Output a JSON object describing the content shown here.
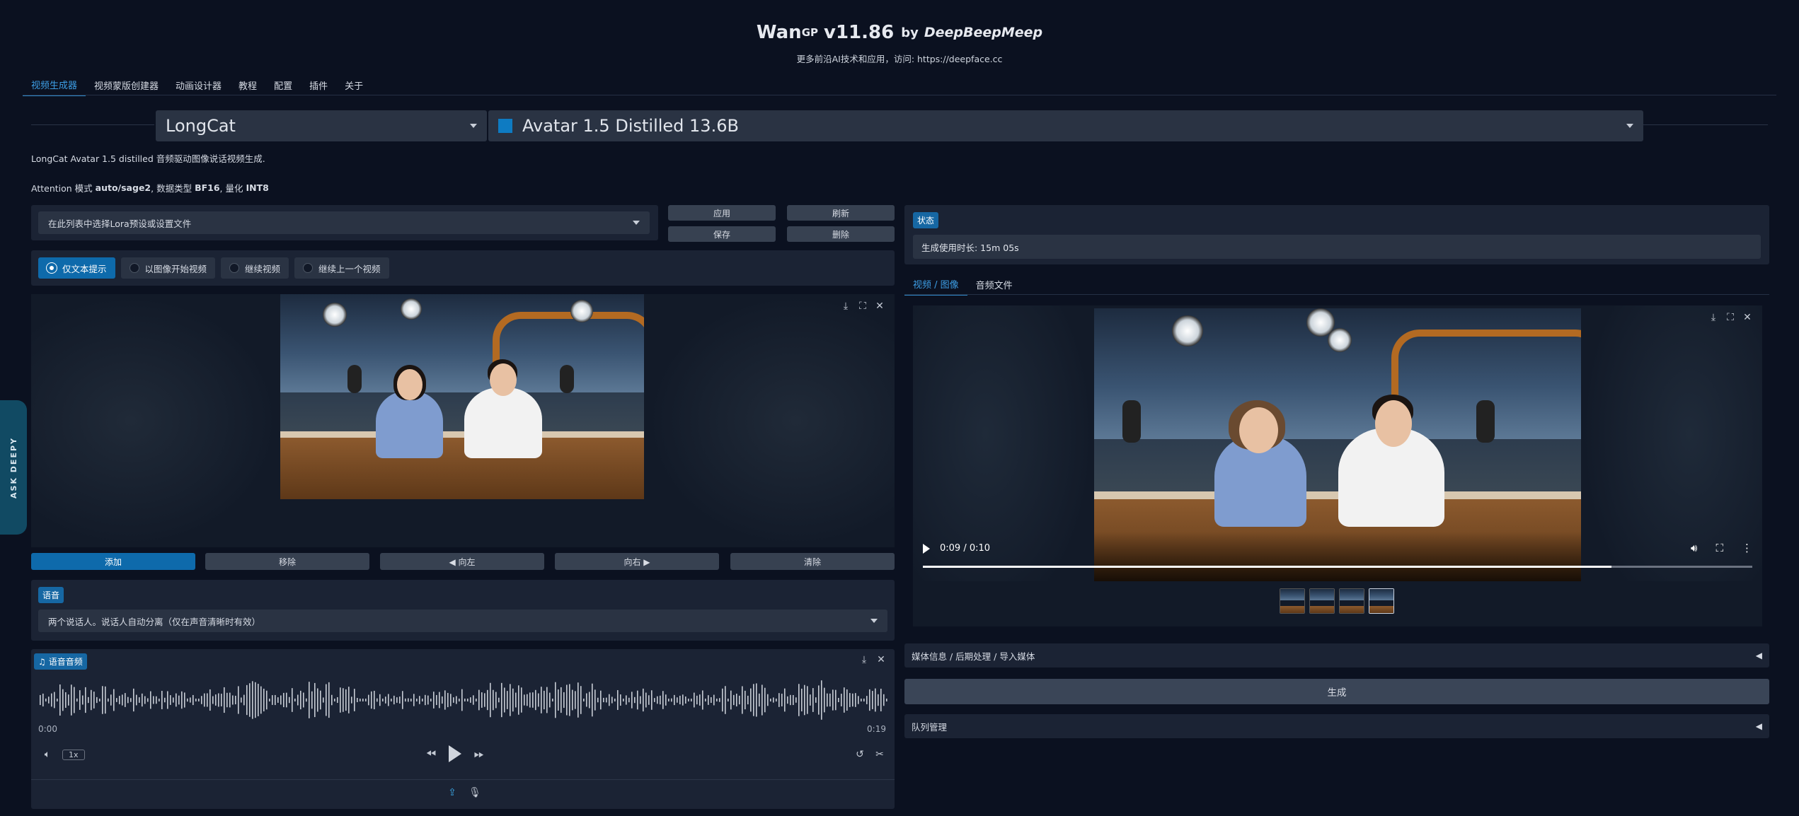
{
  "header": {
    "title": "Wan",
    "title_sup": "GP",
    "version": "v11.86",
    "by": "by",
    "author": "DeepBeepMeep",
    "subtitle": "更多前沿AI技术和应用，访问: https://deepface.cc"
  },
  "tabs": [
    "视频生成器",
    "视频蒙版创建器",
    "动画设计器",
    "教程",
    "配置",
    "插件",
    "关于"
  ],
  "active_tab": 0,
  "model_family": "LongCat",
  "model_name": "Avatar 1.5 Distilled 13.6B",
  "model_color": "#0e7bc2",
  "description": "LongCat Avatar 1.5 distilled 音频驱动图像说话视频生成.",
  "attention": {
    "prefix": "Attention 模式",
    "mode": "auto/sage2",
    "dtype_label": ", 数据类型",
    "dtype": "BF16",
    "quant_label": ", 量化",
    "quant": "INT8"
  },
  "lora": {
    "placeholder": "在此列表中选择Lora预设或设置文件",
    "apply": "应用",
    "refresh": "刷新",
    "save": "保存",
    "delete": "删除"
  },
  "mode_options": [
    "仅文本提示",
    "以图像开始视频",
    "继续视频",
    "继续上一个视频"
  ],
  "mode_selected": 0,
  "gallery_buttons": {
    "add": "添加",
    "remove": "移除",
    "left": "◀ 向左",
    "right": "向右 ▶",
    "clear": "清除"
  },
  "speech": {
    "label": "语音",
    "value": "两个说话人。说话人自动分离（仅在声音清晰时有效）"
  },
  "audio": {
    "label": "语音音频",
    "time_start": "0:00",
    "time_end": "0:19",
    "speed": "1x"
  },
  "status": {
    "label": "状态",
    "text": "生成使用时长: 15m 05s"
  },
  "output_tabs": [
    "视频 / 图像",
    "音频文件"
  ],
  "output_active_tab": 0,
  "player": {
    "time": "0:09 / 0:10",
    "progress": 0.83
  },
  "media_info": "媒体信息 / 后期处理 / 导入媒体",
  "generate": "生成",
  "queue": "队列管理",
  "side_tab": "ASK DEEPY"
}
